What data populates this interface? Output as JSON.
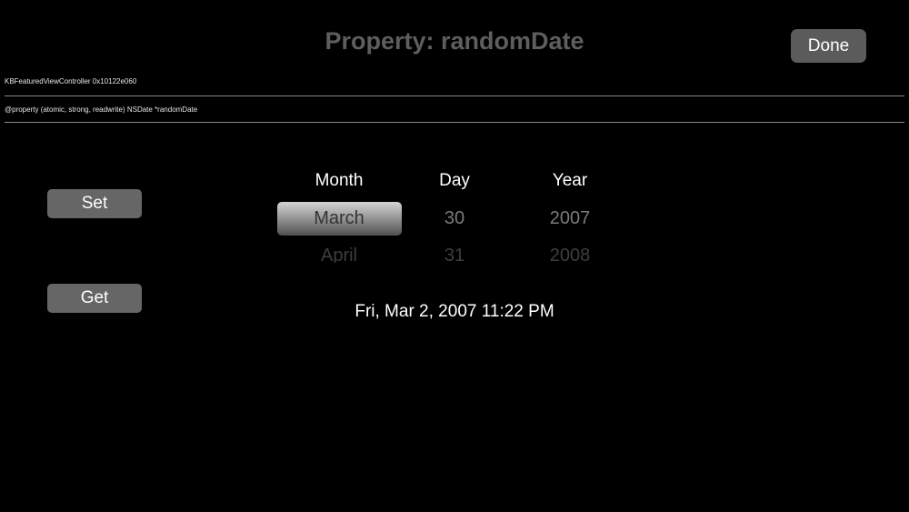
{
  "header": {
    "title": "Property: randomDate",
    "done_label": "Done"
  },
  "info": {
    "controller": "KBFeaturedViewController 0x10122e060",
    "property_decl": "@property (atomic, strong, readwrite) NSDate *randomDate"
  },
  "actions": {
    "set_label": "Set",
    "get_label": "Get"
  },
  "picker": {
    "columns": [
      {
        "header": "Month",
        "selected": "March",
        "next": "April"
      },
      {
        "header": "Day",
        "selected": "30",
        "next": "31"
      },
      {
        "header": "Year",
        "selected": "2007",
        "next": "2008"
      }
    ]
  },
  "result": {
    "date_text": "Fri, Mar 2, 2007 11:22 PM"
  },
  "colors": {
    "background": "#000000",
    "button": "#5b5b5b",
    "title": "#5e5e5e"
  }
}
